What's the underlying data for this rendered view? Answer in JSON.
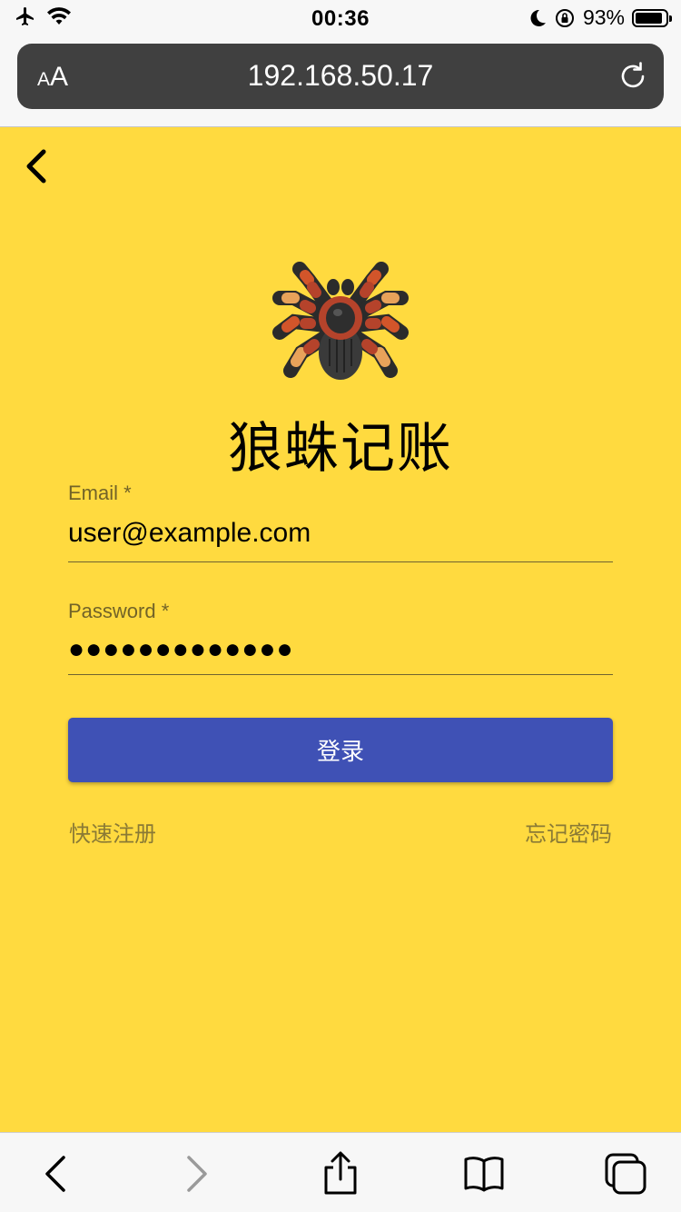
{
  "status_bar": {
    "time": "00:36",
    "battery_percent": "93%",
    "battery_level": 0.93,
    "icons": [
      "airplane-icon",
      "wifi-icon",
      "moon-icon",
      "orientation-lock-icon",
      "battery-icon"
    ]
  },
  "browser": {
    "text_size_label_small": "A",
    "text_size_label_large": "A",
    "url": "192.168.50.17",
    "toolbar_icons": [
      "back-icon",
      "forward-icon",
      "share-icon",
      "bookmarks-icon",
      "tabs-icon"
    ]
  },
  "page": {
    "background": "#ffda3f",
    "title": "狼蛛记账",
    "form": {
      "email_label": "Email *",
      "email_value": "user@example.com",
      "password_label": "Password *",
      "password_value": "●●●●●●●●●●●●●",
      "login_button": "登录"
    },
    "links": {
      "register": "快速注册",
      "forgot_password": "忘记密码"
    },
    "accent_color": "#3f51b5"
  }
}
